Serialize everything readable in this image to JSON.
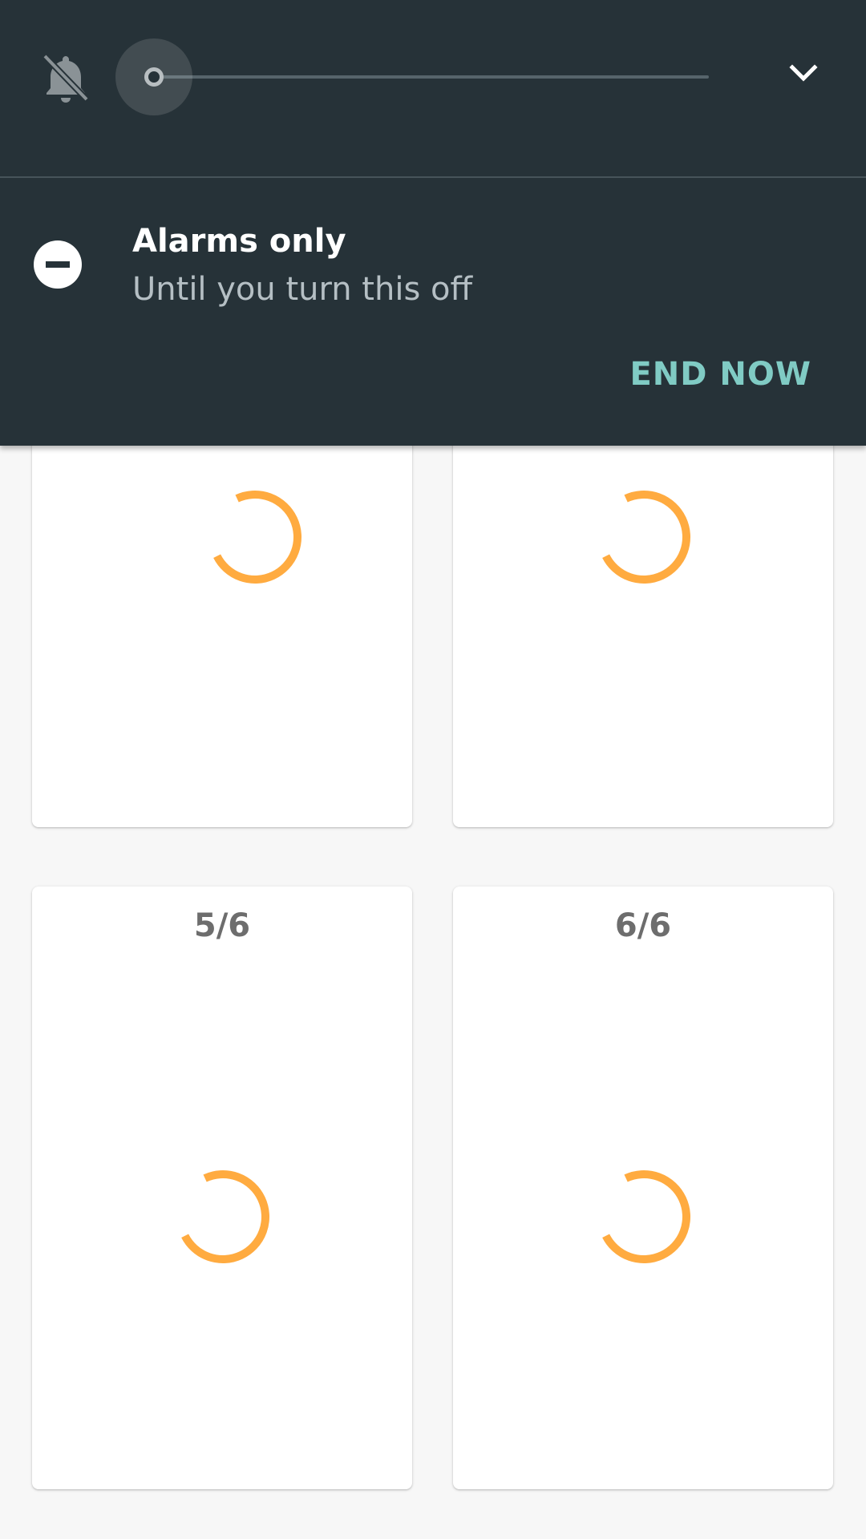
{
  "volume_panel": {
    "ringer_icon": "bell-off-icon",
    "expand_icon": "chevron-down-icon",
    "slider_level": 0
  },
  "dnd_banner": {
    "icon": "minus-circle-icon",
    "title": "Alarms only",
    "subtitle": "Until you turn this off",
    "action_label": "END NOW"
  },
  "cards": [
    {
      "label": "",
      "status": "loading"
    },
    {
      "label": "",
      "status": "loading"
    },
    {
      "label": "5/6",
      "status": "loading"
    },
    {
      "label": "6/6",
      "status": "loading"
    }
  ],
  "colors": {
    "panel_bg": "#263238",
    "accent_action": "#80cbc4",
    "spinner": "#ffab40",
    "page_bg": "#f7f7f7"
  }
}
